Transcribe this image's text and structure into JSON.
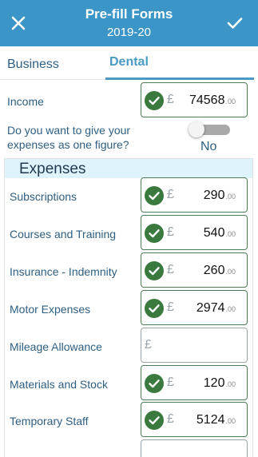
{
  "header": {
    "title": "Pre-fill Forms",
    "subtitle": "2019-20",
    "close_icon": "close-icon",
    "confirm_icon": "check-icon"
  },
  "tabs": [
    {
      "label": "Business",
      "active": false
    },
    {
      "label": "Dental",
      "active": true
    }
  ],
  "income": {
    "label": "Income",
    "currency": "£",
    "value": "74568",
    "cents": ".00"
  },
  "single_figure": {
    "question": "Do you want to give your expenses as one figure?",
    "value": "No",
    "enabled": false
  },
  "expenses": {
    "title": "Expenses",
    "items": [
      {
        "label": "Subscriptions",
        "currency": "£",
        "value": "290",
        "cents": ".00",
        "checked": true
      },
      {
        "label": "Courses and Training",
        "currency": "£",
        "value": "540",
        "cents": ".00",
        "checked": true
      },
      {
        "label": "Insurance - Indemnity",
        "currency": "£",
        "value": "260",
        "cents": ".00",
        "checked": true
      },
      {
        "label": "Motor Expenses",
        "currency": "£",
        "value": "2974",
        "cents": ".00",
        "checked": true
      },
      {
        "label": "Mileage Allowance",
        "currency": "£",
        "value": "",
        "cents": "",
        "checked": false
      },
      {
        "label": "Materials and Stock",
        "currency": "£",
        "value": "120",
        "cents": ".00",
        "checked": true
      },
      {
        "label": "Temporary Staff",
        "currency": "£",
        "value": "5124",
        "cents": ".00",
        "checked": true
      }
    ]
  },
  "colors": {
    "header_bg": "#3b95c6",
    "accent": "#4a9ac4",
    "check_green": "#3a7a3f",
    "section_bg": "#dff3fd"
  }
}
